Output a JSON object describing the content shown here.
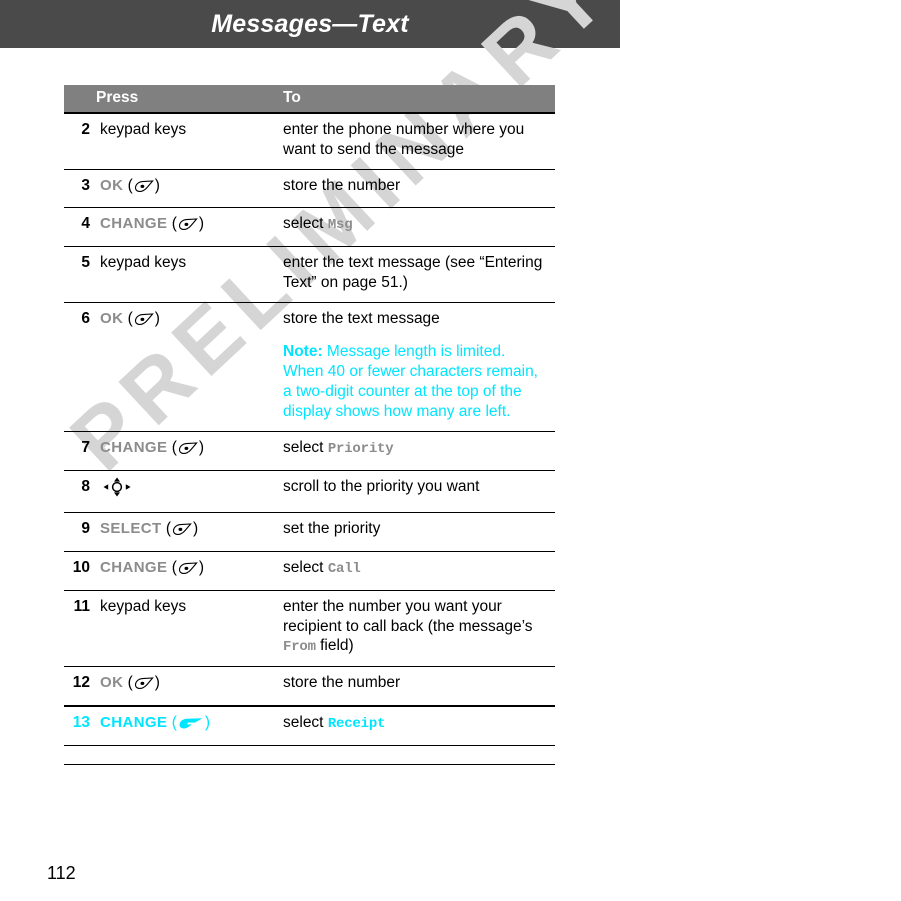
{
  "header": {
    "title": "Messages—Text"
  },
  "watermark": {
    "text": "PRELIMINARY",
    "color": "#d5d5d5"
  },
  "colors": {
    "header_bg": "#4a4a4a",
    "table_header_bg": "#808080",
    "accent_cyan": "#00e5ff",
    "key_gray": "#8c8c8c"
  },
  "table": {
    "columns": [
      "Press",
      "To"
    ],
    "rows": [
      {
        "num": "2",
        "press_text": "keypad keys",
        "press_key": null,
        "press_icon": null,
        "to_prefix": "enter the phone number where you want to send the message",
        "to_term": null,
        "to_suffix": null,
        "cyan": false
      },
      {
        "num": "3",
        "press_text": null,
        "press_key": "OK",
        "press_icon": "softkey-icon",
        "to_prefix": "store the number",
        "to_term": null,
        "to_suffix": null,
        "cyan": false
      },
      {
        "num": "4",
        "press_text": null,
        "press_key": "CHANGE",
        "press_icon": "softkey-icon",
        "to_prefix": "select ",
        "to_term": "Msg",
        "to_suffix": null,
        "cyan": false
      },
      {
        "num": "5",
        "press_text": "keypad keys",
        "press_key": null,
        "press_icon": null,
        "to_prefix": "enter the text message (see “Entering Text” on page 51.)",
        "to_term": null,
        "to_suffix": null,
        "cyan": false
      },
      {
        "num": "6",
        "press_text": null,
        "press_key": "OK",
        "press_icon": "softkey-icon",
        "to_prefix": "store the text message",
        "to_term": null,
        "to_suffix": null,
        "note_label": "Note:",
        "note_text": " Message length is limited. When 40 or fewer characters remain, a two-digit counter at the top of the display shows how many are left.",
        "cyan": false
      },
      {
        "num": "7",
        "press_text": null,
        "press_key": "CHANGE",
        "press_icon": "softkey-icon",
        "to_prefix": "select ",
        "to_term": "Priority",
        "to_suffix": null,
        "cyan": false
      },
      {
        "num": "8",
        "press_text": null,
        "press_key": null,
        "press_icon": "nav-key-icon",
        "to_prefix": "scroll to the priority you want",
        "to_term": null,
        "to_suffix": null,
        "cyan": false
      },
      {
        "num": "9",
        "press_text": null,
        "press_key": "SELECT",
        "press_icon": "softkey-icon",
        "to_prefix": "set the priority",
        "to_term": null,
        "to_suffix": null,
        "cyan": false
      },
      {
        "num": "10",
        "press_text": null,
        "press_key": "CHANGE",
        "press_icon": "softkey-icon",
        "to_prefix": "select ",
        "to_term": "Call",
        "to_suffix": null,
        "cyan": false
      },
      {
        "num": "11",
        "press_text": "keypad keys",
        "press_key": null,
        "press_icon": null,
        "to_prefix": "enter the number you want your recipient to call back (the message’s ",
        "to_term": "From",
        "to_suffix": " field)",
        "cyan": false
      },
      {
        "num": "12",
        "press_text": null,
        "press_key": "OK",
        "press_icon": "softkey-icon",
        "to_prefix": "store the number",
        "to_term": null,
        "to_suffix": null,
        "cyan": false
      },
      {
        "num": "13",
        "press_text": null,
        "press_key": "CHANGE",
        "press_icon": "softkey-filled-icon",
        "to_prefix": "select ",
        "to_term": "Receipt",
        "to_suffix": null,
        "cyan": true
      }
    ]
  },
  "footer": {
    "page_number": "112"
  }
}
